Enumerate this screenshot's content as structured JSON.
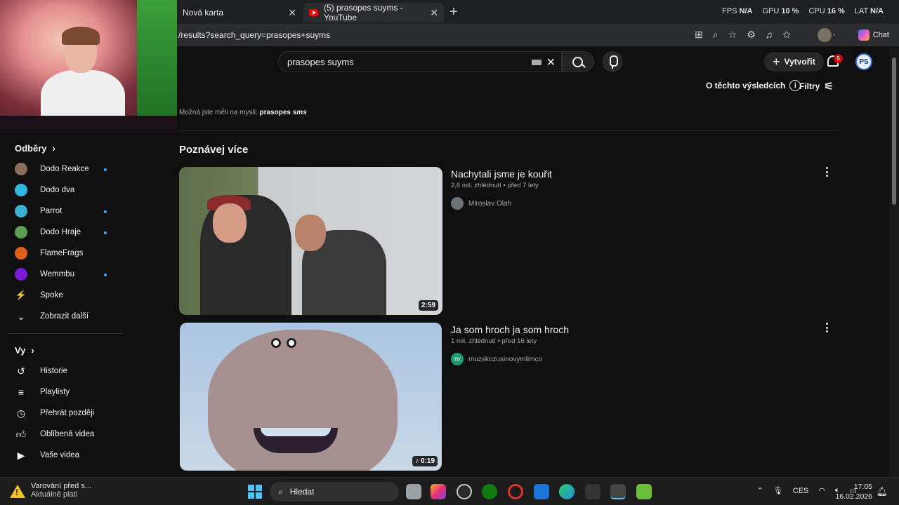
{
  "browser": {
    "tabs": [
      {
        "label": "Nová karta"
      },
      {
        "label": "(5) prasopes suyms - YouTube"
      }
    ],
    "url": "/results?search_query=prasopes+suyms",
    "chat_label": "Chat",
    "stats": {
      "fps_label": "FPS",
      "fps_value": "N/A",
      "gpu_label": "GPU",
      "gpu_value": "10 %",
      "cpu_label": "CPU",
      "cpu_value": "16 %",
      "lat_label": "LAT",
      "lat_value": "N/A"
    }
  },
  "youtube": {
    "search_value": "prasopes suyms",
    "create_label": "Vytvořit",
    "notification_count": "5",
    "user_initials": "PS",
    "about_results": "O těchto výsledcích",
    "filters": "Filtry",
    "did_you_mean_prefix": "Možná jste měli na mysli:",
    "did_you_mean_word": "prasopes",
    "did_you_mean_italic": "sms",
    "section_title": "Poznávej více",
    "videos": [
      {
        "title": "Nachytali jsme je kouřit",
        "views": "2,6 mil. zhlédnutí",
        "age": "před 7 lety",
        "channel": "Miroslav Olah",
        "duration": "2:59"
      },
      {
        "title": "Ja som hroch ja som hroch",
        "views": "1 mil. zhlédnutí",
        "age": "před 16 lety",
        "channel": "muzskozusinovymlimco",
        "duration": "0:19",
        "channel_initial": "m"
      }
    ]
  },
  "sidebar": {
    "subscriptions_title": "Odběry",
    "subscriptions": [
      {
        "label": "Dodo Reakce",
        "color": "#8a6d5a",
        "new": true
      },
      {
        "label": "Dodo dva",
        "color": "#2fb8e0",
        "new": false
      },
      {
        "label": "Parrot",
        "color": "#3cb0d0",
        "new": true
      },
      {
        "label": "Dodo Hraje",
        "color": "#5aa050",
        "new": true
      },
      {
        "label": "FlameFrags",
        "color": "#e0601a",
        "new": false
      },
      {
        "label": "Wemmbu",
        "color": "#7a18d8",
        "new": true
      },
      {
        "label": "Spoke",
        "color": "#101010",
        "new": false
      }
    ],
    "show_more": "Zobrazit další",
    "you_title": "Vy",
    "you_items": [
      {
        "label": "Historie",
        "icon": "history-icon"
      },
      {
        "label": "Playlisty",
        "icon": "playlist-icon"
      },
      {
        "label": "Přehrát později",
        "icon": "clock-icon"
      },
      {
        "label": "Oblíbená videa",
        "icon": "thumbs-up-icon"
      },
      {
        "label": "Vaše videa",
        "icon": "play-square-icon"
      }
    ]
  },
  "taskbar": {
    "warning_title": "Varování před s...",
    "warning_sub": "Aktuálně platí",
    "search_label": "Hledat",
    "language": "CES",
    "time": "17:05",
    "date": "16.02.2026"
  },
  "colors": {
    "accent": "#3ea6ff",
    "brand": "#ff0000",
    "badge": "#cc0000"
  }
}
